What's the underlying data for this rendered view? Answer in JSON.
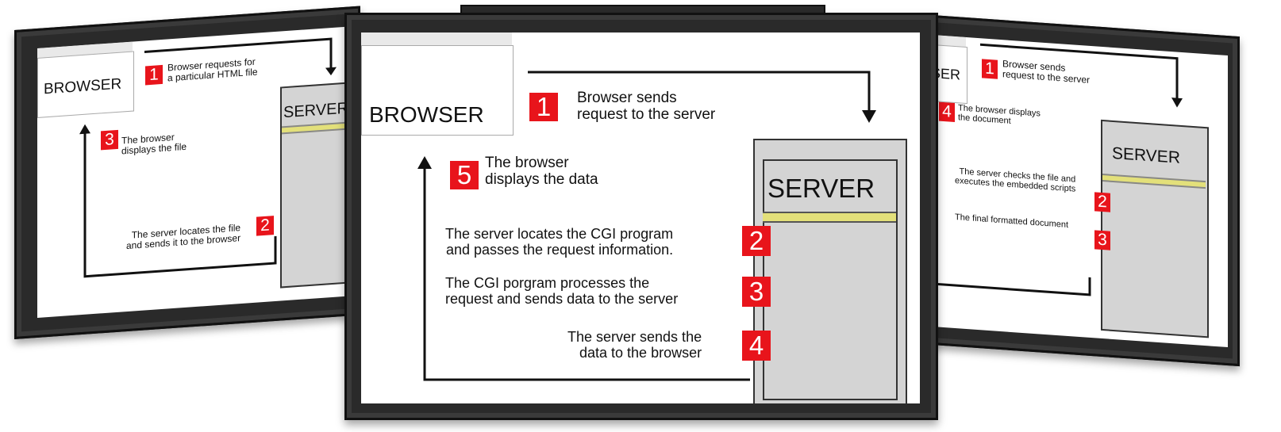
{
  "left": {
    "browser_label": "BROWSER",
    "server_label": "SERVER",
    "steps": [
      {
        "num": "1",
        "text": "Browser requests for\na particular HTML file"
      },
      {
        "num": "2",
        "text": "The server locates the file\nand sends it to the browser"
      },
      {
        "num": "3",
        "text": "The browser\ndisplays the file"
      }
    ]
  },
  "center": {
    "browser_label": "BROWSER",
    "server_label": "SERVER",
    "steps": [
      {
        "num": "1",
        "text": "Browser sends\nrequest to the server"
      },
      {
        "num": "2",
        "text": "The server locates the CGI program\nand passes the request information."
      },
      {
        "num": "3",
        "text": "The CGI porgram processes the\nrequest and sends data to the server"
      },
      {
        "num": "4",
        "text": "The server sends the\ndata to the browser"
      },
      {
        "num": "5",
        "text": "The browser\ndisplays the data"
      }
    ]
  },
  "right": {
    "browser_label": "SER",
    "server_label": "SERVER",
    "steps": [
      {
        "num": "1",
        "text": "Browser sends\nrequest to the server"
      },
      {
        "num": "2",
        "text": "The server checks the file and\nexecutes the embedded scripts"
      },
      {
        "num": "3",
        "text": "The final formatted document"
      },
      {
        "num": "4",
        "text": "The browser displays\nthe document"
      }
    ]
  },
  "colors": {
    "badge": "#e8141b",
    "server_stripe": "#e3e07a",
    "frame": "#2a2a2a"
  }
}
